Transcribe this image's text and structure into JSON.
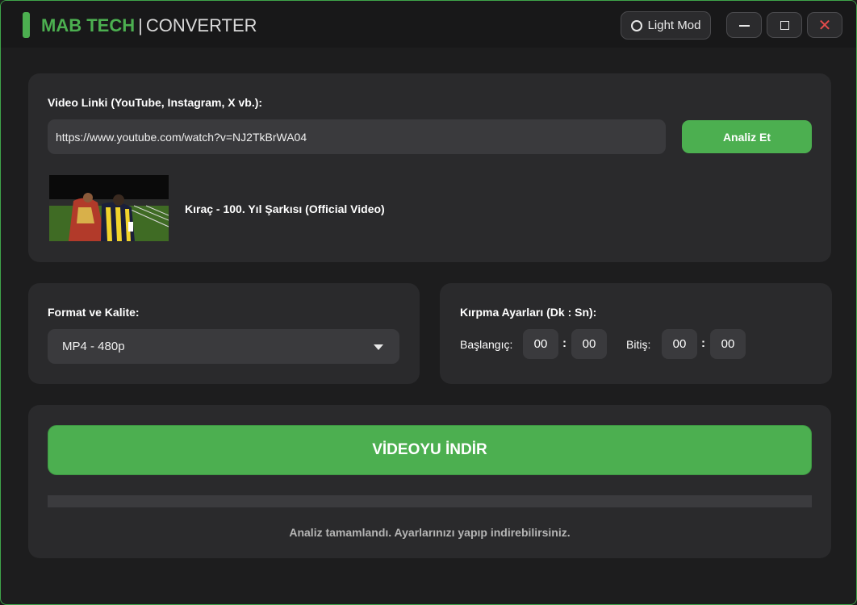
{
  "app": {
    "brand_strong": "MAB TECH",
    "separator": "|",
    "brand_light": "CONVERTER"
  },
  "window_controls": {
    "theme_label": "Light Mod",
    "close_glyph": "✕"
  },
  "link_section": {
    "label": "Video Linki (YouTube, Instagram, X vb.):",
    "url_value": "https://www.youtube.com/watch?v=NJ2TkBrWA04",
    "analyze_label": "Analiz Et",
    "video_title": "Kıraç - 100. Yıl Şarkısı (Official Video)"
  },
  "format_section": {
    "label": "Format ve Kalite:",
    "selected": "MP4 - 480p"
  },
  "trim_section": {
    "label": "Kırpma Ayarları (Dk : Sn):",
    "start_label": "Başlangıç:",
    "end_label": "Bitiş:",
    "start_min": "00",
    "start_sec": "00",
    "end_min": "00",
    "end_sec": "00",
    "colon": ":"
  },
  "download_section": {
    "button_label": "VİDEOYU İNDİR",
    "progress": 0,
    "status": "Analiz tamamlandı. Ayarlarınızı yapıp indirebilirsiniz."
  },
  "colors": {
    "accent": "#4caf50",
    "background": "#1d1d1e",
    "card": "#2a2a2c",
    "close": "#e34b4b"
  },
  "icons": [
    "sun-icon",
    "minimize-icon",
    "maximize-icon",
    "close-icon",
    "chevron-down-icon"
  ]
}
